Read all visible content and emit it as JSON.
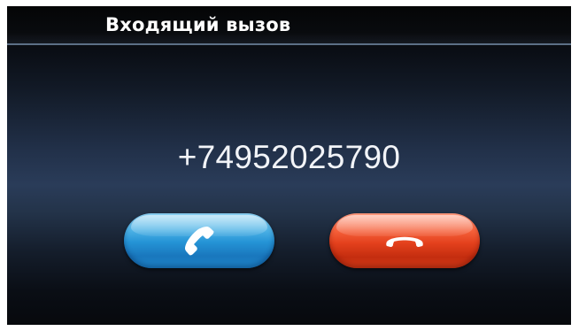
{
  "header": {
    "title": "Входящий вызов"
  },
  "call": {
    "number": "+74952025790"
  },
  "actions": {
    "accept_icon": "phone-handset-icon",
    "decline_icon": "hang-up-icon"
  },
  "colors": {
    "accept": "#2594d6",
    "decline": "#e3401c"
  }
}
